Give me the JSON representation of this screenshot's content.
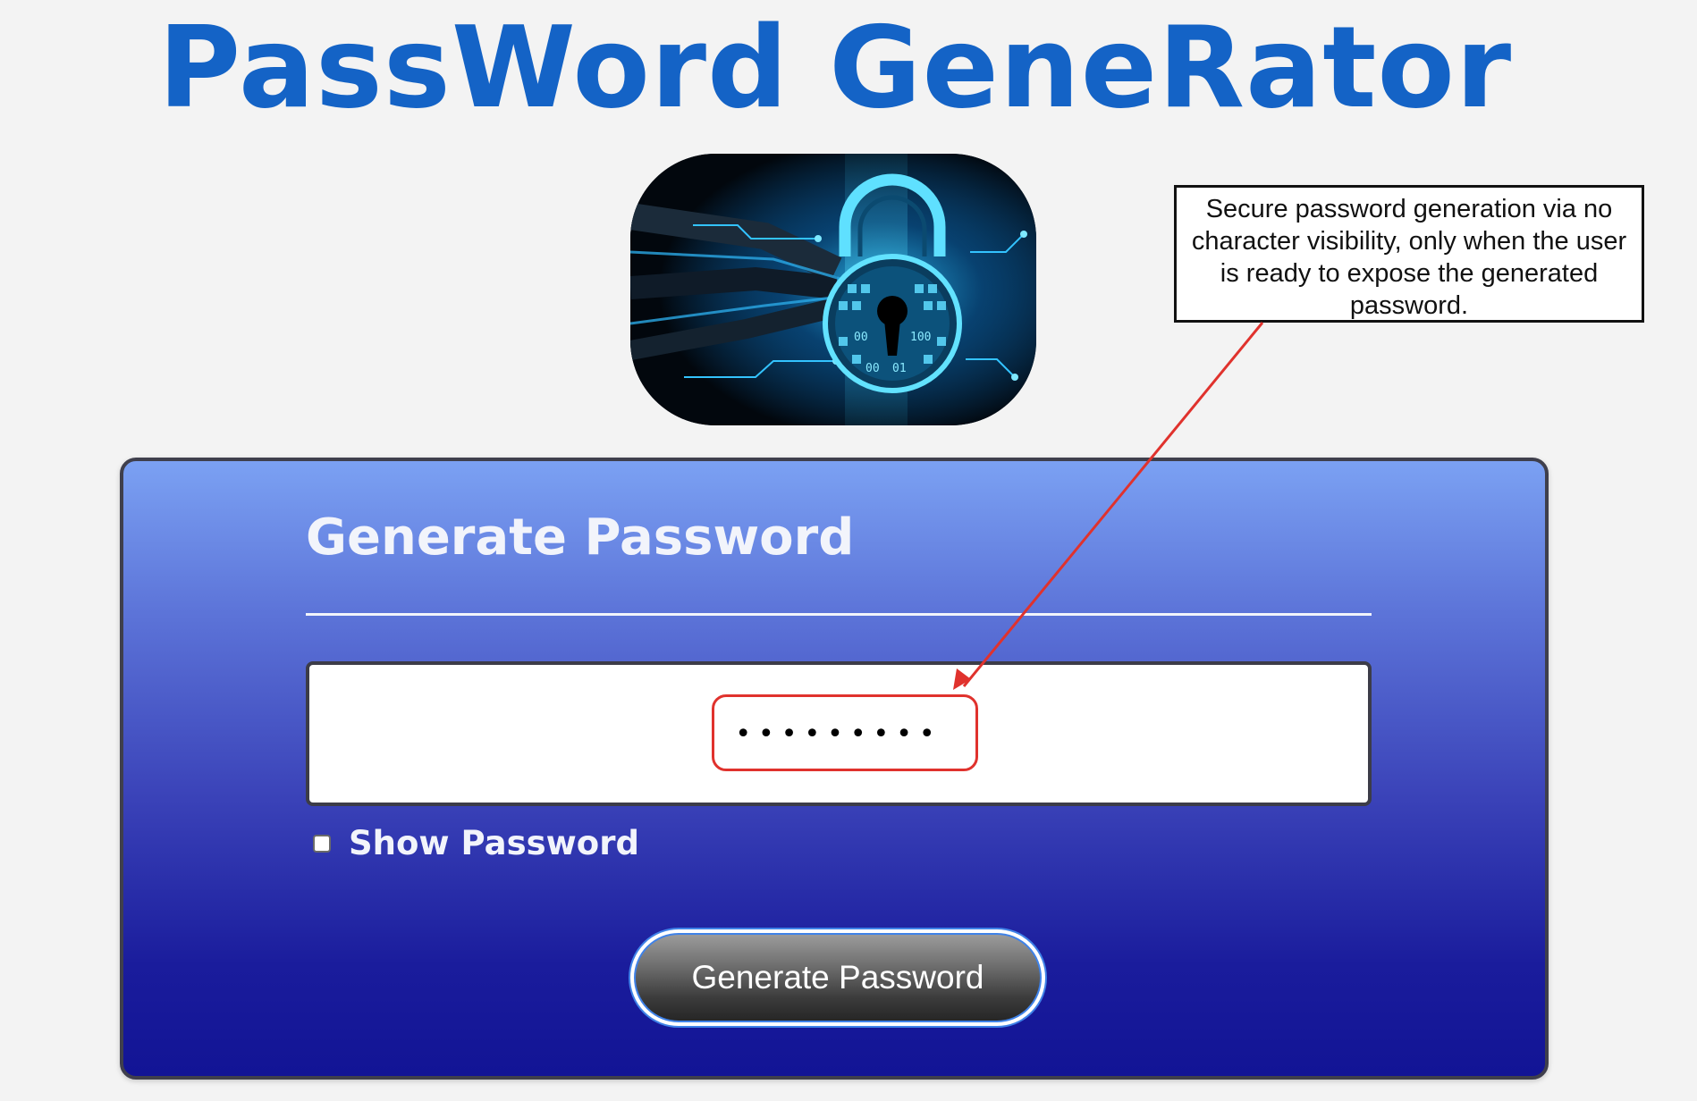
{
  "page": {
    "title": "PassWord GeneRator",
    "accent_color": "#1463c6"
  },
  "hero": {
    "icon": "padlock-icon",
    "binary_glyphs": [
      "00",
      "01",
      "100",
      "00"
    ]
  },
  "callout": {
    "text": "Secure password generation via no character visibility, only when the user is ready to expose the generated password.",
    "arrow_color": "#e0322d"
  },
  "panel": {
    "heading": "Generate Password",
    "password_field": {
      "masked_value": "•••••••••"
    },
    "show_password": {
      "label": "Show Password",
      "checked": false
    },
    "generate_button": {
      "label": "Generate Password"
    }
  }
}
